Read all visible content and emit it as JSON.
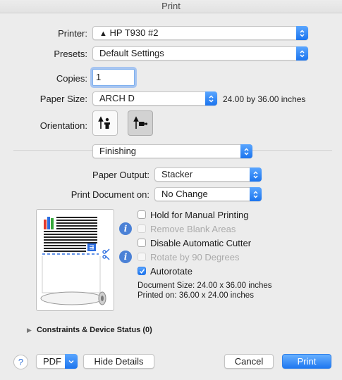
{
  "window": {
    "title": "Print"
  },
  "printer": {
    "label": "Printer:",
    "value": "HP T930 #2"
  },
  "presets": {
    "label": "Presets:",
    "value": "Default Settings"
  },
  "copies": {
    "label": "Copies:",
    "value": "1"
  },
  "paper_size": {
    "label": "Paper Size:",
    "value": "ARCH D",
    "dimensions": "24.00 by 36.00 inches"
  },
  "orientation": {
    "label": "Orientation:",
    "options": [
      "portrait",
      "landscape"
    ],
    "selected": "landscape"
  },
  "section": {
    "value": "Finishing"
  },
  "paper_output": {
    "label": "Paper Output:",
    "value": "Stacker"
  },
  "print_document_on": {
    "label": "Print Document on:",
    "value": "No Change"
  },
  "options": [
    {
      "label": "Hold for Manual Printing",
      "checked": false,
      "enabled": true
    },
    {
      "label": "Remove Blank Areas",
      "checked": false,
      "enabled": false
    },
    {
      "label": "Disable Automatic Cutter",
      "checked": false,
      "enabled": true
    },
    {
      "label": "Rotate by 90 Degrees",
      "checked": false,
      "enabled": false
    },
    {
      "label": "Autorotate",
      "checked": true,
      "enabled": true
    }
  ],
  "document_size": "Document Size: 24.00 x 36.00 inches",
  "printed_on": "Printed on: 36.00 x 24.00 inches",
  "constraints": {
    "label": "Constraints & Device Status (0)"
  },
  "footer": {
    "help_label": "?",
    "pdf_label": "PDF",
    "hide_details_label": "Hide Details",
    "cancel_label": "Cancel",
    "print_label": "Print"
  },
  "colors": {
    "accent": "#1b74ee",
    "info": "#4b81d6"
  },
  "icons": {
    "warning": "warning-icon",
    "stepper": "popup-stepper-icon",
    "info": "info-icon",
    "scissors": "scissors-icon",
    "checkmark": "checkmark-icon",
    "disclosure": "disclosure-triangle-icon"
  }
}
